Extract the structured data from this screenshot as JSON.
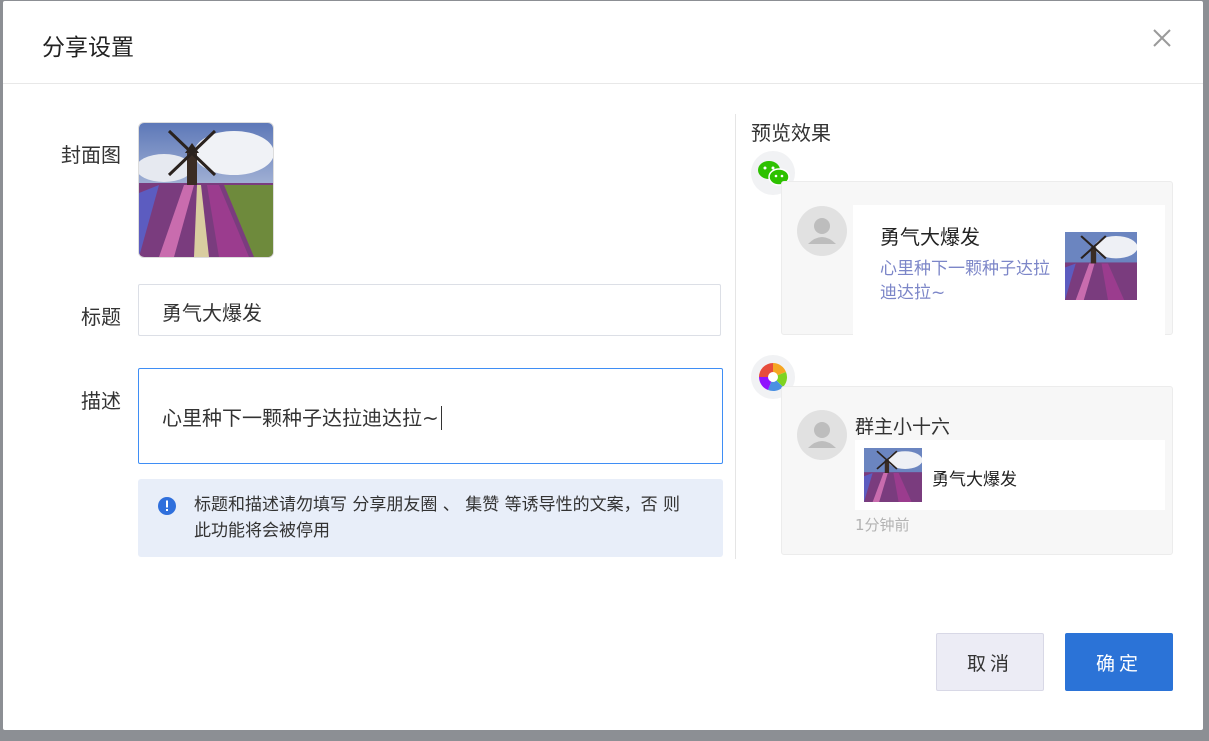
{
  "dialog": {
    "title": "分享设置"
  },
  "form": {
    "cover_label": "封面图",
    "title_label": "标题",
    "title_value": "勇气大爆发",
    "desc_label": "描述",
    "desc_value": "心里种下一颗种子达拉迪达拉~",
    "notice": "标题和描述请勿填写 分享朋友圈 、 集赞 等诱导性的文案，否 则此功能将会被停用"
  },
  "preview": {
    "title": "预览效果",
    "wechat": {
      "title": "勇气大爆发",
      "desc": "心里种下一颗种子达拉迪达拉~"
    },
    "moments": {
      "name": "群主小十六",
      "text": "勇气大爆发",
      "time": "1分钟前"
    }
  },
  "buttons": {
    "cancel": "取消",
    "confirm": "确定"
  },
  "colors": {
    "primary": "#2b73d7",
    "focus_border": "#3f8ef5",
    "notice_bg": "#e8eef9",
    "wechat_green": "#2dc100",
    "desc_link": "#7c86c8"
  }
}
